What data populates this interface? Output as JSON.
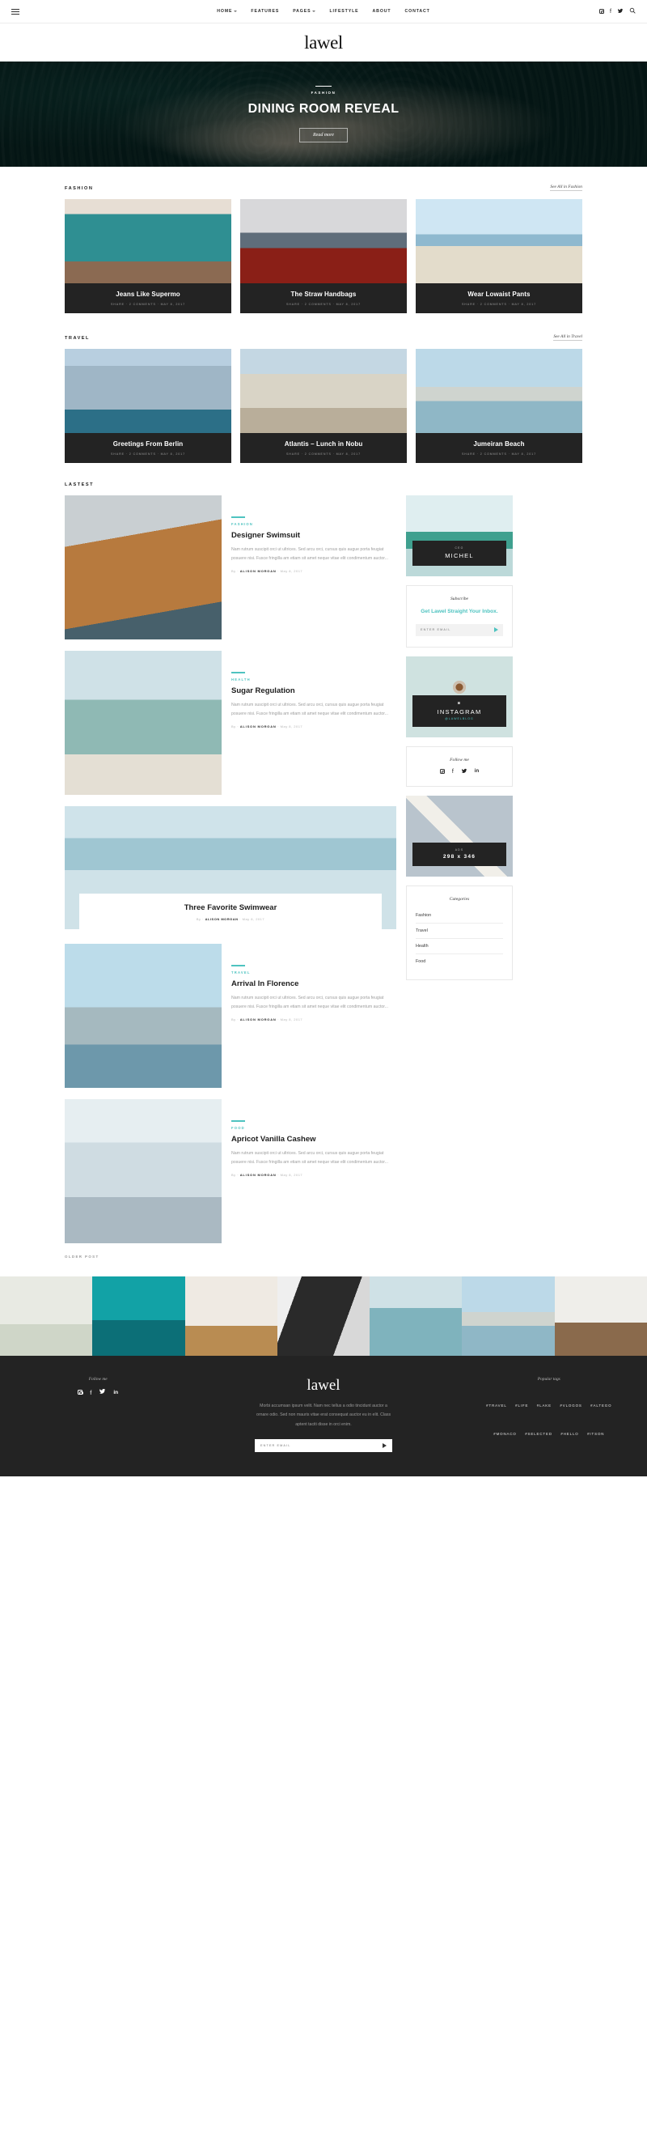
{
  "topbar": {
    "menu_icon": "hamburger-icon",
    "nav": [
      {
        "label": "HOME",
        "has_caret": true
      },
      {
        "label": "FEATURES",
        "has_caret": false
      },
      {
        "label": "PAGES",
        "has_caret": true
      },
      {
        "label": "LIFESTYLE",
        "has_caret": false
      },
      {
        "label": "ABOUT",
        "has_caret": false
      },
      {
        "label": "CONTACT",
        "has_caret": false
      }
    ],
    "icons": [
      "instagram-icon",
      "facebook-icon",
      "twitter-icon",
      "search-icon"
    ],
    "facebook": "f",
    "twitter": "🐦",
    "search": "⌕"
  },
  "brand": {
    "logo": "lawel"
  },
  "hero": {
    "category": "FASHION",
    "title": "DINING ROOM REVEAL",
    "button": "Read more"
  },
  "fashion_section": {
    "title": "FASHION",
    "see_all": "See All in Fashion",
    "cards": [
      {
        "title": "Jeans Like Supermo",
        "meta": "SHARE  ·  2 COMMENTS  ·  MAY 8, 2017",
        "img": "im-door"
      },
      {
        "title": "The Straw Handbags",
        "meta": "SHARE  ·  2 COMMENTS  ·  MAY 8, 2017",
        "img": "im-washer"
      },
      {
        "title": "Wear Lowaist Pants",
        "meta": "SHARE  ·  2 COMMENTS  ·  MAY 8, 2017",
        "img": "im-beach"
      }
    ]
  },
  "travel_section": {
    "title": "TRAVEL",
    "see_all": "See All in Travel",
    "cards": [
      {
        "title": "Greetings From Berlin",
        "meta": "SHARE  ·  2 COMMENTS  ·  MAY 8, 2017",
        "img": "im-berlin"
      },
      {
        "title": "Atlantis – Lunch in Nobu",
        "meta": "SHARE  ·  2 COMMENTS  ·  MAY 8, 2017",
        "img": "im-nobu"
      },
      {
        "title": "Jumeiran Beach",
        "meta": "SHARE  ·  2 COMMENTS  ·  MAY 8, 2017",
        "img": "im-jumeiran"
      }
    ]
  },
  "latest_section": {
    "title": "LASTEST",
    "older_link": "OLDER POST",
    "excerpt": "Nam rutrum suscipit orci ut ultrices. Sed arcu orci, cursus quis augue porta feugiat posuere nisi. Fusce fringilla am etiam sit amet neque vitae elit condimentum auctor...",
    "posts": [
      {
        "category": "FASHION",
        "title": "Designer Swimsuit",
        "by_prefix": "By",
        "author": "ALISON MORGAN",
        "date": "May 8, 2017",
        "img": "im-hair"
      },
      {
        "category": "HEALTH",
        "title": "Sugar Regulation",
        "by_prefix": "By",
        "author": "ALISON MORGAN",
        "date": "May 8, 2017",
        "img": "im-lifeguard"
      },
      {
        "category": "TRAVEL",
        "title": "Arrival In Florence",
        "by_prefix": "By",
        "author": "ALISON MORGAN",
        "date": "May 8, 2017",
        "img": "im-pier"
      },
      {
        "category": "FOOD",
        "title": "Apricot Vanilla Cashew",
        "by_prefix": "By",
        "author": "ALISON MORGAN",
        "date": "May 8, 2017",
        "img": "im-astro"
      }
    ],
    "wide_post": {
      "title": "Three Favorite Swimwear",
      "by_prefix": "By",
      "author": "ALISON MORGAN",
      "date": "May 8, 2017",
      "img": "im-sea"
    }
  },
  "sidebar": {
    "ceo_widget": {
      "small": "CEO",
      "big": "MICHEL",
      "img": "im-surf"
    },
    "subscribe": {
      "title": "Subscribe",
      "headline": "Get Lawel Straight Your Inbox.",
      "placeholder": "ENTER EMAIL",
      "send_icon": "send-arrow-icon"
    },
    "instagram_widget": {
      "small_icon": "instagram-icon",
      "big": "INSTAGRAM",
      "handle": "@LAWELBLOG",
      "img": "im-coffee"
    },
    "follow": {
      "title": "Follow me",
      "icons": [
        "instagram-icon",
        "facebook-icon",
        "twitter-icon",
        "linkedin-icon"
      ],
      "facebook": "f",
      "twitter": "🐦",
      "linkedin": "in"
    },
    "ad": {
      "small": "ADS",
      "size": "298 x 346",
      "img": "im-ad"
    },
    "categories": {
      "title": "Categories",
      "items": [
        "Fashion",
        "Travel",
        "Health",
        "Food"
      ]
    }
  },
  "instagram_strip": {
    "images": [
      "im-flower",
      "im-hand",
      "im-stool",
      "im-bw",
      "im-wave",
      "im-jumeiran",
      "im-book"
    ]
  },
  "footer": {
    "follow_label": "Follow me",
    "social": [
      "instagram-icon",
      "facebook-icon",
      "twitter-icon",
      "linkedin-icon"
    ],
    "facebook": "f",
    "twitter": "🐦",
    "linkedin": "in",
    "logo": "lawel",
    "text": "Morbi accumsan ipsum velit. Nam nec tellus a odio tincidunt auctor a ornare odio. Sed non mauris vitae erat consequat auctor eu in elit. Class aptent taciti disse in orci enim.",
    "placeholder": "ENTER EMAIL",
    "send_icon": "send-arrow-icon",
    "tags_label": "Popular tags",
    "tags": [
      "#TRAVEL",
      "#LIFE",
      "#LAKE",
      "#VLOGOS",
      "#ALTEGO",
      "#MONACO",
      "#SELECTED",
      "#HELLO",
      "#ITSON"
    ]
  },
  "colors": {
    "accent": "#4ec3c0",
    "dark": "#232323",
    "hero_dark": "#06211e"
  }
}
